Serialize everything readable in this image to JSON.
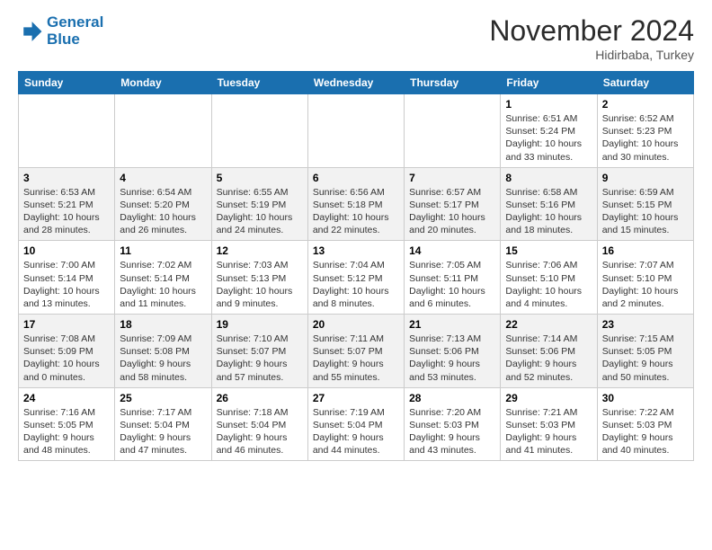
{
  "header": {
    "logo_line1": "General",
    "logo_line2": "Blue",
    "month": "November 2024",
    "location": "Hidirbaba, Turkey"
  },
  "weekdays": [
    "Sunday",
    "Monday",
    "Tuesday",
    "Wednesday",
    "Thursday",
    "Friday",
    "Saturday"
  ],
  "weeks": [
    [
      {
        "day": "",
        "info": ""
      },
      {
        "day": "",
        "info": ""
      },
      {
        "day": "",
        "info": ""
      },
      {
        "day": "",
        "info": ""
      },
      {
        "day": "",
        "info": ""
      },
      {
        "day": "1",
        "info": "Sunrise: 6:51 AM\nSunset: 5:24 PM\nDaylight: 10 hours\nand 33 minutes."
      },
      {
        "day": "2",
        "info": "Sunrise: 6:52 AM\nSunset: 5:23 PM\nDaylight: 10 hours\nand 30 minutes."
      }
    ],
    [
      {
        "day": "3",
        "info": "Sunrise: 6:53 AM\nSunset: 5:21 PM\nDaylight: 10 hours\nand 28 minutes."
      },
      {
        "day": "4",
        "info": "Sunrise: 6:54 AM\nSunset: 5:20 PM\nDaylight: 10 hours\nand 26 minutes."
      },
      {
        "day": "5",
        "info": "Sunrise: 6:55 AM\nSunset: 5:19 PM\nDaylight: 10 hours\nand 24 minutes."
      },
      {
        "day": "6",
        "info": "Sunrise: 6:56 AM\nSunset: 5:18 PM\nDaylight: 10 hours\nand 22 minutes."
      },
      {
        "day": "7",
        "info": "Sunrise: 6:57 AM\nSunset: 5:17 PM\nDaylight: 10 hours\nand 20 minutes."
      },
      {
        "day": "8",
        "info": "Sunrise: 6:58 AM\nSunset: 5:16 PM\nDaylight: 10 hours\nand 18 minutes."
      },
      {
        "day": "9",
        "info": "Sunrise: 6:59 AM\nSunset: 5:15 PM\nDaylight: 10 hours\nand 15 minutes."
      }
    ],
    [
      {
        "day": "10",
        "info": "Sunrise: 7:00 AM\nSunset: 5:14 PM\nDaylight: 10 hours\nand 13 minutes."
      },
      {
        "day": "11",
        "info": "Sunrise: 7:02 AM\nSunset: 5:14 PM\nDaylight: 10 hours\nand 11 minutes."
      },
      {
        "day": "12",
        "info": "Sunrise: 7:03 AM\nSunset: 5:13 PM\nDaylight: 10 hours\nand 9 minutes."
      },
      {
        "day": "13",
        "info": "Sunrise: 7:04 AM\nSunset: 5:12 PM\nDaylight: 10 hours\nand 8 minutes."
      },
      {
        "day": "14",
        "info": "Sunrise: 7:05 AM\nSunset: 5:11 PM\nDaylight: 10 hours\nand 6 minutes."
      },
      {
        "day": "15",
        "info": "Sunrise: 7:06 AM\nSunset: 5:10 PM\nDaylight: 10 hours\nand 4 minutes."
      },
      {
        "day": "16",
        "info": "Sunrise: 7:07 AM\nSunset: 5:10 PM\nDaylight: 10 hours\nand 2 minutes."
      }
    ],
    [
      {
        "day": "17",
        "info": "Sunrise: 7:08 AM\nSunset: 5:09 PM\nDaylight: 10 hours\nand 0 minutes."
      },
      {
        "day": "18",
        "info": "Sunrise: 7:09 AM\nSunset: 5:08 PM\nDaylight: 9 hours\nand 58 minutes."
      },
      {
        "day": "19",
        "info": "Sunrise: 7:10 AM\nSunset: 5:07 PM\nDaylight: 9 hours\nand 57 minutes."
      },
      {
        "day": "20",
        "info": "Sunrise: 7:11 AM\nSunset: 5:07 PM\nDaylight: 9 hours\nand 55 minutes."
      },
      {
        "day": "21",
        "info": "Sunrise: 7:13 AM\nSunset: 5:06 PM\nDaylight: 9 hours\nand 53 minutes."
      },
      {
        "day": "22",
        "info": "Sunrise: 7:14 AM\nSunset: 5:06 PM\nDaylight: 9 hours\nand 52 minutes."
      },
      {
        "day": "23",
        "info": "Sunrise: 7:15 AM\nSunset: 5:05 PM\nDaylight: 9 hours\nand 50 minutes."
      }
    ],
    [
      {
        "day": "24",
        "info": "Sunrise: 7:16 AM\nSunset: 5:05 PM\nDaylight: 9 hours\nand 48 minutes."
      },
      {
        "day": "25",
        "info": "Sunrise: 7:17 AM\nSunset: 5:04 PM\nDaylight: 9 hours\nand 47 minutes."
      },
      {
        "day": "26",
        "info": "Sunrise: 7:18 AM\nSunset: 5:04 PM\nDaylight: 9 hours\nand 46 minutes."
      },
      {
        "day": "27",
        "info": "Sunrise: 7:19 AM\nSunset: 5:04 PM\nDaylight: 9 hours\nand 44 minutes."
      },
      {
        "day": "28",
        "info": "Sunrise: 7:20 AM\nSunset: 5:03 PM\nDaylight: 9 hours\nand 43 minutes."
      },
      {
        "day": "29",
        "info": "Sunrise: 7:21 AM\nSunset: 5:03 PM\nDaylight: 9 hours\nand 41 minutes."
      },
      {
        "day": "30",
        "info": "Sunrise: 7:22 AM\nSunset: 5:03 PM\nDaylight: 9 hours\nand 40 minutes."
      }
    ]
  ]
}
